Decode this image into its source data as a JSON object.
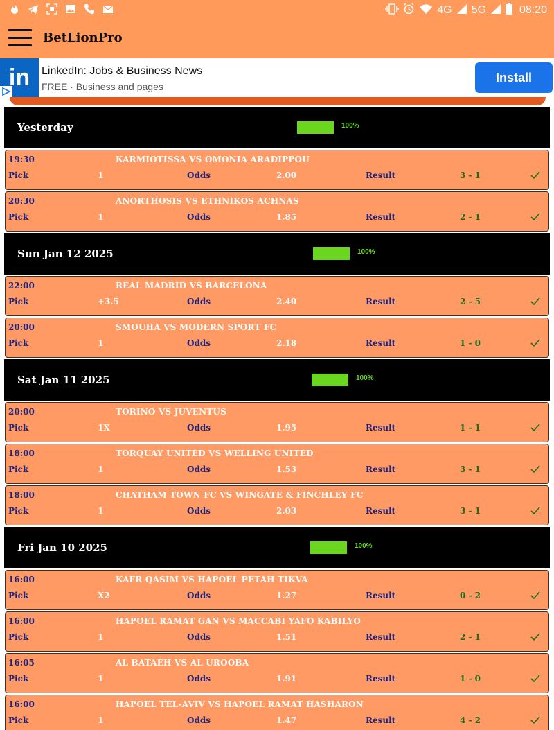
{
  "status_bar": {
    "time": "08:20",
    "network_4g": "4G",
    "network_5g": "5G"
  },
  "app": {
    "title": "BetLionPro"
  },
  "ad": {
    "logo_text": "in",
    "title": "LinkedIn: Jobs & Business News",
    "subtitle": "FREE · Business and pages",
    "install_label": "Install"
  },
  "labels": {
    "pick": "Pick",
    "odds": "Odds",
    "result": "Result"
  },
  "days": [
    {
      "title": "Yesterday",
      "percent": "100%",
      "progress": 1.0,
      "matches": [
        {
          "time": "19:30",
          "match": "KARMIOTISSA VS OMONIA ARADIPPOU",
          "pick": "1",
          "odds": "2.00",
          "result": "3 - 1"
        },
        {
          "time": "20:30",
          "match": "ANORTHOSIS VS ETHNIKOS ACHNAS",
          "pick": "1",
          "odds": "1.85",
          "result": "2 - 1"
        }
      ]
    },
    {
      "title": "Sun Jan 12 2025",
      "percent": "100%",
      "progress": 1.0,
      "matches": [
        {
          "time": "22:00",
          "match": "REAL MADRID VS BARCELONA",
          "pick": "+3.5",
          "odds": "2.40",
          "result": "2 - 5"
        },
        {
          "time": "20:00",
          "match": "SMOUHA VS MODERN SPORT FC",
          "pick": "1",
          "odds": "2.18",
          "result": "1 - 0"
        }
      ]
    },
    {
      "title": "Sat Jan 11 2025",
      "percent": "100%",
      "progress": 1.0,
      "matches": [
        {
          "time": "20:00",
          "match": "TORINO VS JUVENTUS",
          "pick": "1X",
          "odds": "1.95",
          "result": "1 - 1"
        },
        {
          "time": "18:00",
          "match": "TORQUAY UNITED VS WELLING UNITED",
          "pick": "1",
          "odds": "1.53",
          "result": "3 - 1"
        },
        {
          "time": "18:00",
          "match": "CHATHAM TOWN FC VS WINGATE & FINCHLEY FC",
          "pick": "1",
          "odds": "2.03",
          "result": "3 - 1"
        }
      ]
    },
    {
      "title": "Fri Jan 10 2025",
      "percent": "100%",
      "progress": 1.0,
      "matches": [
        {
          "time": "16:00",
          "match": "KAFR QASIM VS HAPOEL PETAH TIKVA",
          "pick": "X2",
          "odds": "1.27",
          "result": "0 - 2"
        },
        {
          "time": "16:00",
          "match": "HAPOEL RAMAT GAN VS MACCABI YAFO KABILYO",
          "pick": "1",
          "odds": "1.51",
          "result": "2 - 1"
        },
        {
          "time": "16:05",
          "match": "AL BATAEH VS AL UROOBA",
          "pick": "1",
          "odds": "1.91",
          "result": "1 - 0"
        },
        {
          "time": "16:00",
          "match": "HAPOEL TEL-AVIV VS HAPOEL RAMAT HASHARON",
          "pick": "1",
          "odds": "1.47",
          "result": "4 - 2"
        }
      ]
    }
  ],
  "colors": {
    "header_orange": "#ff9a5a",
    "card_orange": "#ff9a64",
    "progress_green": "#6ad61e",
    "label_navy": "#1a237e",
    "result_green": "#1b6e1b",
    "install_blue": "#1a73e8",
    "linkedin_blue": "#0a66c2"
  },
  "icons": {
    "status_left": [
      "flame-icon",
      "telegram-icon",
      "scan-icon",
      "image-icon",
      "phone-icon",
      "mail-icon"
    ],
    "status_right": [
      "vibrate-icon",
      "alarm-icon",
      "wifi-icon",
      "signal-icon",
      "battery-icon"
    ],
    "row_status": "check-icon"
  }
}
